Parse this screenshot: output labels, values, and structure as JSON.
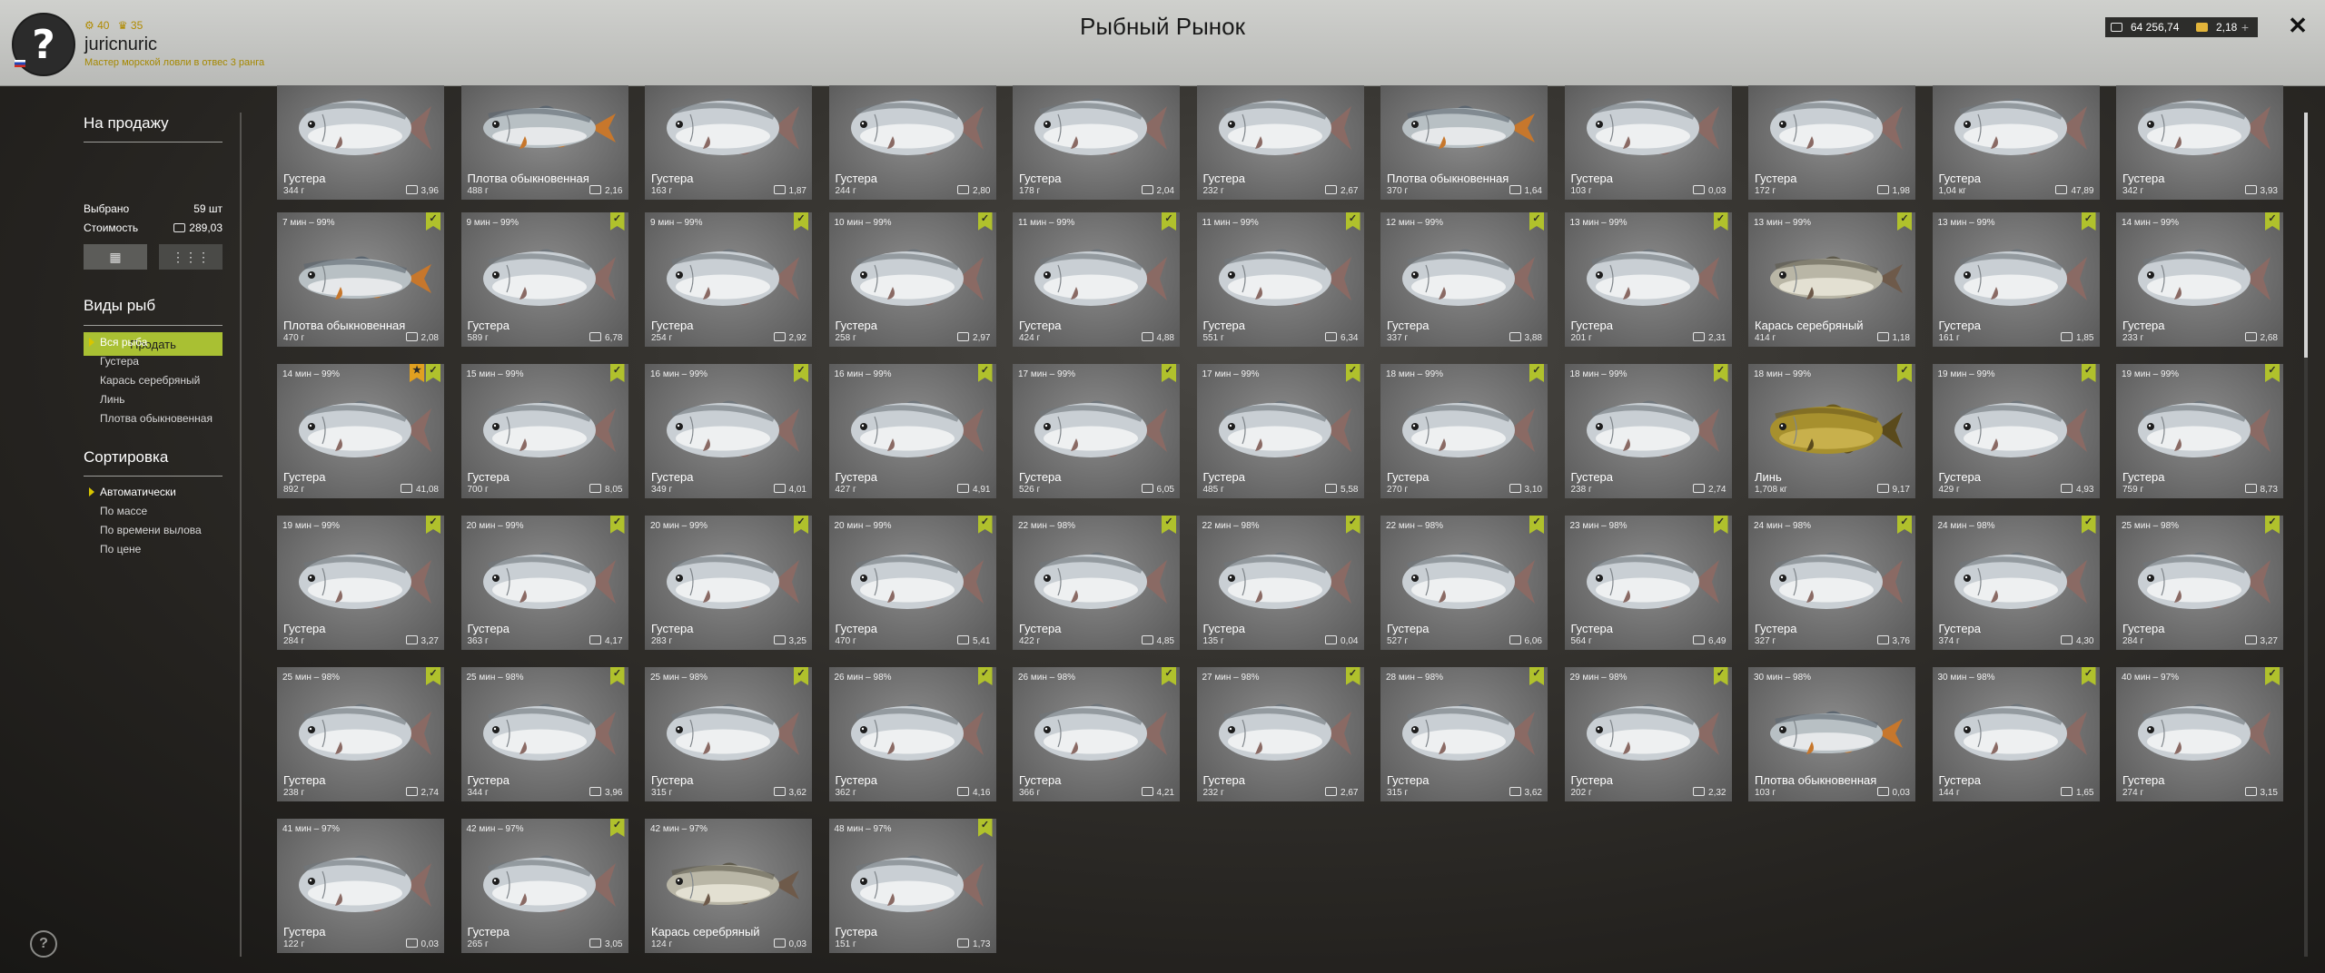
{
  "header": {
    "avatar_glyph": "?",
    "stat_a": "⚙ 40",
    "stat_b": "♛ 35",
    "username": "juricnuric",
    "rank": "Мастер морской ловли в отвес 3 ранга",
    "title": "Рыбный Рынок",
    "silver_amount": "64 256,74",
    "gold_amount": "2,18",
    "plus": "+",
    "close": "✕"
  },
  "sidebar": {
    "sale_title": "На продажу",
    "view_grid_large": "▦",
    "view_grid_small": "⋮⋮⋮",
    "selected_label": "Выбрано",
    "selected_value": "59 шт",
    "cost_label": "Стоимость",
    "cost_value": "289,03",
    "sell_button": "Продать",
    "species_title": "Виды рыб",
    "species": [
      "Вся рыба",
      "Густера",
      "Карась серебряный",
      "Линь",
      "Плотва обыкновенная"
    ],
    "species_active": 0,
    "sort_title": "Сортировка",
    "sort": [
      "Автоматически",
      "По массе",
      "По времени вылова",
      "По цене"
    ],
    "sort_active": 0,
    "help": "?"
  },
  "colors": {
    "accent": "#a9c033",
    "bookmark_green": "#b0c12c",
    "bookmark_orange": "#e0a020"
  },
  "cards": [
    {
      "name": "Густера",
      "weight": "344 г",
      "price": "3,96",
      "time": "",
      "check": false,
      "star": false,
      "kind": "bream"
    },
    {
      "name": "Плотва обыкновенная",
      "weight": "488 г",
      "price": "2,16",
      "time": "",
      "check": false,
      "star": false,
      "kind": "roach"
    },
    {
      "name": "Густера",
      "weight": "163 г",
      "price": "1,87",
      "time": "",
      "check": false,
      "star": false,
      "kind": "bream"
    },
    {
      "name": "Густера",
      "weight": "244 г",
      "price": "2,80",
      "time": "",
      "check": false,
      "star": false,
      "kind": "bream"
    },
    {
      "name": "Густера",
      "weight": "178 г",
      "price": "2,04",
      "time": "",
      "check": false,
      "star": false,
      "kind": "bream"
    },
    {
      "name": "Густера",
      "weight": "232 г",
      "price": "2,67",
      "time": "",
      "check": false,
      "star": false,
      "kind": "bream"
    },
    {
      "name": "Плотва обыкновенная",
      "weight": "370 г",
      "price": "1,64",
      "time": "",
      "check": false,
      "star": false,
      "kind": "roach"
    },
    {
      "name": "Густера",
      "weight": "103 г",
      "price": "0,03",
      "time": "",
      "check": false,
      "star": false,
      "kind": "bream"
    },
    {
      "name": "Густера",
      "weight": "172 г",
      "price": "1,98",
      "time": "",
      "check": false,
      "star": false,
      "kind": "bream"
    },
    {
      "name": "Густера",
      "weight": "1,04 кг",
      "price": "47,89",
      "time": "",
      "check": false,
      "star": false,
      "kind": "bream"
    },
    {
      "name": "Густера",
      "weight": "342 г",
      "price": "3,93",
      "time": "",
      "check": false,
      "star": false,
      "kind": "bream"
    },
    {
      "name": "Плотва обыкновенная",
      "weight": "470 г",
      "price": "2,08",
      "time": "7 мин – 99%",
      "check": true,
      "star": false,
      "kind": "roach"
    },
    {
      "name": "Густера",
      "weight": "589 г",
      "price": "6,78",
      "time": "9 мин – 99%",
      "check": true,
      "star": false,
      "kind": "bream"
    },
    {
      "name": "Густера",
      "weight": "254 г",
      "price": "2,92",
      "time": "9 мин – 99%",
      "check": true,
      "star": false,
      "kind": "bream"
    },
    {
      "name": "Густера",
      "weight": "258 г",
      "price": "2,97",
      "time": "10 мин – 99%",
      "check": true,
      "star": false,
      "kind": "bream"
    },
    {
      "name": "Густера",
      "weight": "424 г",
      "price": "4,88",
      "time": "11 мин – 99%",
      "check": true,
      "star": false,
      "kind": "bream"
    },
    {
      "name": "Густера",
      "weight": "551 г",
      "price": "6,34",
      "time": "11 мин – 99%",
      "check": true,
      "star": false,
      "kind": "bream"
    },
    {
      "name": "Густера",
      "weight": "337 г",
      "price": "3,88",
      "time": "12 мин – 99%",
      "check": true,
      "star": false,
      "kind": "bream"
    },
    {
      "name": "Густера",
      "weight": "201 г",
      "price": "2,31",
      "time": "13 мин – 99%",
      "check": true,
      "star": false,
      "kind": "bream"
    },
    {
      "name": "Карась серебряный",
      "weight": "414 г",
      "price": "1,18",
      "time": "13 мин – 99%",
      "check": true,
      "star": false,
      "kind": "carp"
    },
    {
      "name": "Густера",
      "weight": "161 г",
      "price": "1,85",
      "time": "13 мин – 99%",
      "check": true,
      "star": false,
      "kind": "bream"
    },
    {
      "name": "Густера",
      "weight": "233 г",
      "price": "2,68",
      "time": "14 мин – 99%",
      "check": true,
      "star": false,
      "kind": "bream"
    },
    {
      "name": "Густера",
      "weight": "892 г",
      "price": "41,08",
      "time": "14 мин – 99%",
      "check": true,
      "star": true,
      "kind": "bream"
    },
    {
      "name": "Густера",
      "weight": "700 г",
      "price": "8,05",
      "time": "15 мин – 99%",
      "check": true,
      "star": false,
      "kind": "bream"
    },
    {
      "name": "Густера",
      "weight": "349 г",
      "price": "4,01",
      "time": "16 мин – 99%",
      "check": true,
      "star": false,
      "kind": "bream"
    },
    {
      "name": "Густера",
      "weight": "427 г",
      "price": "4,91",
      "time": "16 мин – 99%",
      "check": true,
      "star": false,
      "kind": "bream"
    },
    {
      "name": "Густера",
      "weight": "526 г",
      "price": "6,05",
      "time": "17 мин – 99%",
      "check": true,
      "star": false,
      "kind": "bream"
    },
    {
      "name": "Густера",
      "weight": "485 г",
      "price": "5,58",
      "time": "17 мин – 99%",
      "check": true,
      "star": false,
      "kind": "bream"
    },
    {
      "name": "Густера",
      "weight": "270 г",
      "price": "3,10",
      "time": "18 мин – 99%",
      "check": true,
      "star": false,
      "kind": "bream"
    },
    {
      "name": "Густера",
      "weight": "238 г",
      "price": "2,74",
      "time": "18 мин – 99%",
      "check": true,
      "star": false,
      "kind": "bream"
    },
    {
      "name": "Линь",
      "weight": "1,708 кг",
      "price": "9,17",
      "time": "18 мин – 99%",
      "check": true,
      "star": false,
      "kind": "tench"
    },
    {
      "name": "Густера",
      "weight": "429 г",
      "price": "4,93",
      "time": "19 мин – 99%",
      "check": true,
      "star": false,
      "kind": "bream"
    },
    {
      "name": "Густера",
      "weight": "759 г",
      "price": "8,73",
      "time": "19 мин – 99%",
      "check": true,
      "star": false,
      "kind": "bream"
    },
    {
      "name": "Густера",
      "weight": "284 г",
      "price": "3,27",
      "time": "19 мин – 99%",
      "check": true,
      "star": false,
      "kind": "bream"
    },
    {
      "name": "Густера",
      "weight": "363 г",
      "price": "4,17",
      "time": "20 мин – 99%",
      "check": true,
      "star": false,
      "kind": "bream"
    },
    {
      "name": "Густера",
      "weight": "283 г",
      "price": "3,25",
      "time": "20 мин – 99%",
      "check": true,
      "star": false,
      "kind": "bream"
    },
    {
      "name": "Густера",
      "weight": "470 г",
      "price": "5,41",
      "time": "20 мин – 99%",
      "check": true,
      "star": false,
      "kind": "bream"
    },
    {
      "name": "Густера",
      "weight": "422 г",
      "price": "4,85",
      "time": "22 мин – 98%",
      "check": true,
      "star": false,
      "kind": "bream"
    },
    {
      "name": "Густера",
      "weight": "135 г",
      "price": "0,04",
      "time": "22 мин – 98%",
      "check": true,
      "star": false,
      "kind": "bream"
    },
    {
      "name": "Густера",
      "weight": "527 г",
      "price": "6,06",
      "time": "22 мин – 98%",
      "check": true,
      "star": false,
      "kind": "bream"
    },
    {
      "name": "Густера",
      "weight": "564 г",
      "price": "6,49",
      "time": "23 мин – 98%",
      "check": true,
      "star": false,
      "kind": "bream"
    },
    {
      "name": "Густера",
      "weight": "327 г",
      "price": "3,76",
      "time": "24 мин – 98%",
      "check": true,
      "star": false,
      "kind": "bream"
    },
    {
      "name": "Густера",
      "weight": "374 г",
      "price": "4,30",
      "time": "24 мин – 98%",
      "check": true,
      "star": false,
      "kind": "bream"
    },
    {
      "name": "Густера",
      "weight": "284 г",
      "price": "3,27",
      "time": "25 мин – 98%",
      "check": true,
      "star": false,
      "kind": "bream"
    },
    {
      "name": "Густера",
      "weight": "238 г",
      "price": "2,74",
      "time": "25 мин – 98%",
      "check": true,
      "star": false,
      "kind": "bream"
    },
    {
      "name": "Густера",
      "weight": "344 г",
      "price": "3,96",
      "time": "25 мин – 98%",
      "check": true,
      "star": false,
      "kind": "bream"
    },
    {
      "name": "Густера",
      "weight": "315 г",
      "price": "3,62",
      "time": "25 мин – 98%",
      "check": true,
      "star": false,
      "kind": "bream"
    },
    {
      "name": "Густера",
      "weight": "362 г",
      "price": "4,16",
      "time": "26 мин – 98%",
      "check": true,
      "star": false,
      "kind": "bream"
    },
    {
      "name": "Густера",
      "weight": "366 г",
      "price": "4,21",
      "time": "26 мин – 98%",
      "check": true,
      "star": false,
      "kind": "bream"
    },
    {
      "name": "Густера",
      "weight": "232 г",
      "price": "2,67",
      "time": "27 мин – 98%",
      "check": true,
      "star": false,
      "kind": "bream"
    },
    {
      "name": "Густера",
      "weight": "315 г",
      "price": "3,62",
      "time": "28 мин – 98%",
      "check": true,
      "star": false,
      "kind": "bream"
    },
    {
      "name": "Густера",
      "weight": "202 г",
      "price": "2,32",
      "time": "29 мин – 98%",
      "check": true,
      "star": false,
      "kind": "bream"
    },
    {
      "name": "Плотва обыкновенная",
      "weight": "103 г",
      "price": "0,03",
      "time": "30 мин – 98%",
      "check": false,
      "star": false,
      "kind": "roach"
    },
    {
      "name": "Густера",
      "weight": "144 г",
      "price": "1,65",
      "time": "30 мин – 98%",
      "check": true,
      "star": false,
      "kind": "bream"
    },
    {
      "name": "Густера",
      "weight": "274 г",
      "price": "3,15",
      "time": "40 мин – 97%",
      "check": true,
      "star": false,
      "kind": "bream"
    },
    {
      "name": "Густера",
      "weight": "122 г",
      "price": "0,03",
      "time": "41 мин – 97%",
      "check": false,
      "star": false,
      "kind": "bream"
    },
    {
      "name": "Густера",
      "weight": "265 г",
      "price": "3,05",
      "time": "42 мин – 97%",
      "check": true,
      "star": false,
      "kind": "bream"
    },
    {
      "name": "Карась серебряный",
      "weight": "124 г",
      "price": "0,03",
      "time": "42 мин – 97%",
      "check": false,
      "star": false,
      "kind": "carp"
    },
    {
      "name": "Густера",
      "weight": "151 г",
      "price": "1,73",
      "time": "48 мин – 97%",
      "check": true,
      "star": false,
      "kind": "bream"
    }
  ]
}
